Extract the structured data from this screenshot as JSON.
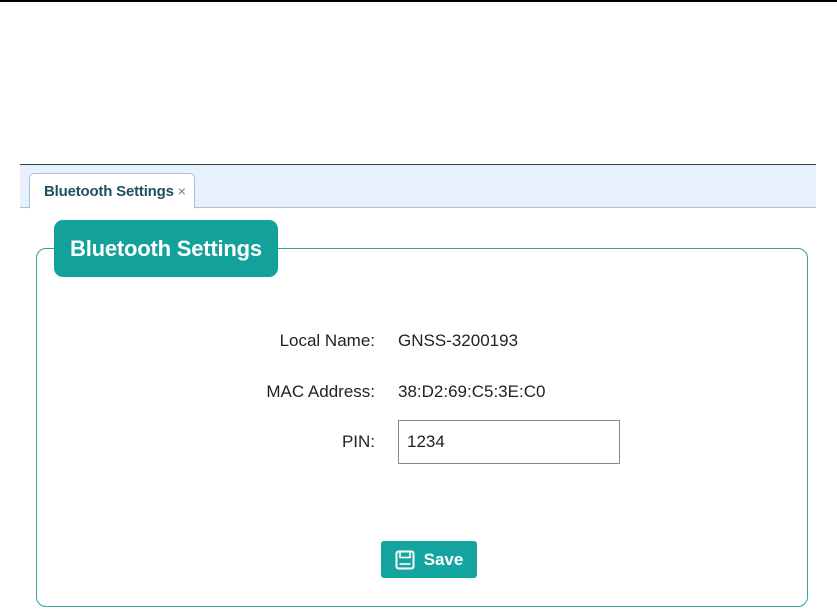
{
  "tabs": [
    {
      "label": "Bluetooth Settings",
      "close_glyph": "×"
    }
  ],
  "panel": {
    "legend": "Bluetooth Settings",
    "fields": {
      "local_name": {
        "label": "Local Name:",
        "value": "GNSS-3200193"
      },
      "mac_address": {
        "label": "MAC Address:",
        "value": "38:D2:69:C5:3E:C0"
      },
      "pin": {
        "label": "PIN:",
        "value": "1234"
      }
    },
    "save_label": "Save"
  },
  "icons": {
    "tab_close": "close-icon",
    "save": "floppy-disk-icon"
  },
  "colors": {
    "accent": "#12a19b",
    "tab_text": "#1f4f63",
    "tabbar_bg": "#e8f0fb"
  }
}
